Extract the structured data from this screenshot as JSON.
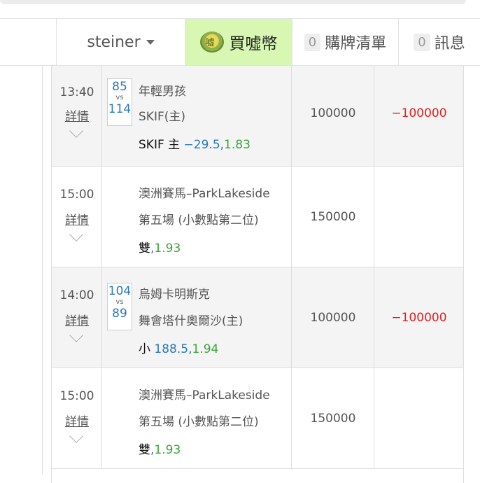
{
  "header": {
    "username": "steiner",
    "buy_label": "買噓幣",
    "cart_count": "0",
    "cart_label": "購牌清單",
    "msg_count": "0",
    "msg_label": "訊息"
  },
  "rows": [
    {
      "time": "13:40",
      "detail": "詳情",
      "score_home": "85",
      "vs": "vs",
      "score_away": "114",
      "line1": "年輕男孩",
      "line2": "SKIF(主)",
      "bet_prefix": "SKIF 主 ",
      "bet_value": "−29.5,",
      "odds": "1.83",
      "amount": "100000",
      "result": "−100000"
    },
    {
      "time": "15:00",
      "detail": "詳情",
      "line1": "澳洲賽馬–ParkLakeside",
      "line2": "第五場 (小數點第二位)",
      "bet_prefix": "雙",
      "bet_value": ",",
      "odds": "1.93",
      "amount": "150000",
      "result": ""
    },
    {
      "time": "14:00",
      "detail": "詳情",
      "score_home": "104",
      "vs": "vs",
      "score_away": "89",
      "line1": "烏姆卡明斯克",
      "line2": "舞會塔什奧爾沙(主)",
      "bet_prefix": "小 ",
      "bet_value": "188.5,",
      "odds": "1.94",
      "amount": "100000",
      "result": "−100000"
    },
    {
      "time": "15:00",
      "detail": "詳情",
      "line1": "澳洲賽馬–ParkLakeside",
      "line2": "第五場 (小數點第二位)",
      "bet_prefix": "雙",
      "bet_value": ",",
      "odds": "1.93",
      "amount": "150000",
      "result": ""
    }
  ]
}
